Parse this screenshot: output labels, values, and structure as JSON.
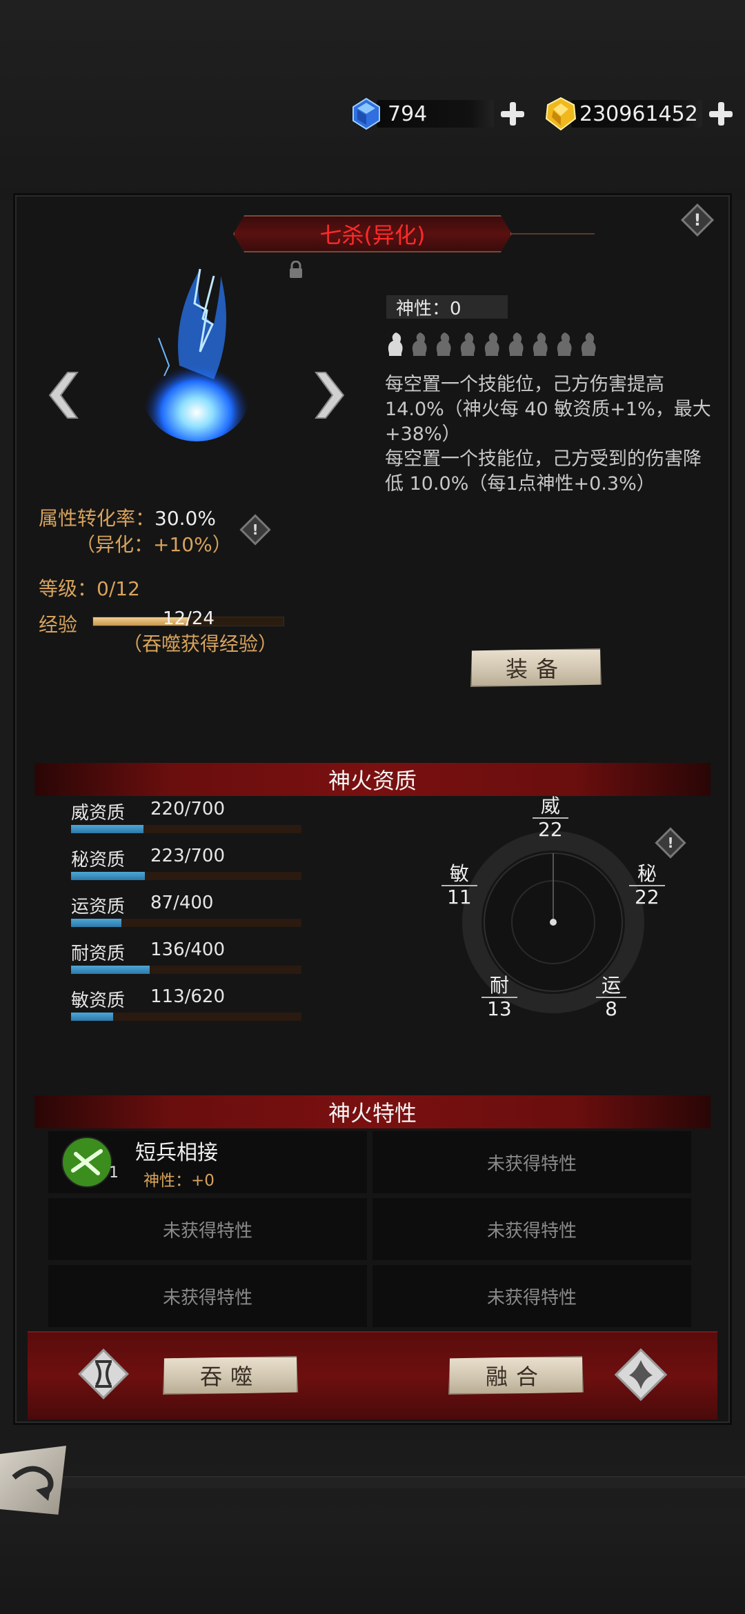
{
  "currency": {
    "gems": "794",
    "gold": "230961452"
  },
  "fire": {
    "title": "七杀(异化)",
    "divinity_label": "神性：0",
    "description_1": "每空置一个技能位，己方伤害提高14.0%（神火每 40 敏资质+1%，最大+38%）",
    "description_2": "每空置一个技能位，己方受到的伤害降低 10.0%（每1点神性+0.3%）",
    "divinity_icons": 9
  },
  "stats": {
    "conversion_label": "属性转化率：",
    "conversion_value": "30.0%",
    "conversion_sub": "（异化：+10%）",
    "level": "等级：0/12",
    "exp_label": "经验",
    "exp_value": "12/24",
    "exp_progress": 0.5,
    "exp_hint": "（吞噬获得经验）"
  },
  "buttons": {
    "equip": "装备",
    "devour": "吞噬",
    "fuse": "融合"
  },
  "aptitude": {
    "section_title": "神火资质",
    "rows": [
      {
        "label": "威资质",
        "value": "220/700",
        "ratio": 0.314
      },
      {
        "label": "秘资质",
        "value": "223/700",
        "ratio": 0.319
      },
      {
        "label": "运资质",
        "value": "87/400",
        "ratio": 0.218
      },
      {
        "label": "耐资质",
        "value": "136/400",
        "ratio": 0.34
      },
      {
        "label": "敏资质",
        "value": "113/620",
        "ratio": 0.182
      }
    ],
    "radar": [
      {
        "name": "威",
        "value": "22"
      },
      {
        "name": "秘",
        "value": "22"
      },
      {
        "name": "运",
        "value": "8"
      },
      {
        "name": "耐",
        "value": "13"
      },
      {
        "name": "敏",
        "value": "11"
      }
    ]
  },
  "traits": {
    "section_title": "神火特性",
    "first_name": "短兵相接",
    "first_level": "1",
    "first_divinity": "神性：+0",
    "empty": "未获得特性"
  },
  "colors": {
    "title_red": "#ff2a2a",
    "label_gold": "#d8a35c",
    "apt_bar": "#3a8fc2",
    "banner_red": "#7a1010"
  }
}
